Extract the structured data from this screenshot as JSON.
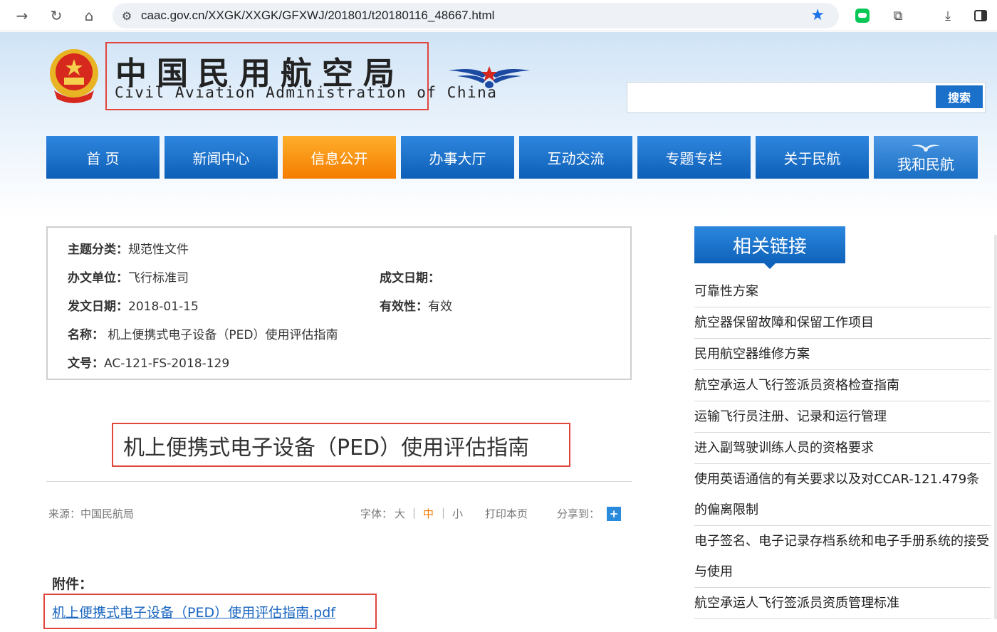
{
  "browser": {
    "url": "caac.gov.cn/XXGK/XXGK/GFXWJ/201801/t20180116_48667.html"
  },
  "site": {
    "logo_cn": "中国民用航空局",
    "logo_en": "Civil Aviation Administration of China",
    "search_button": "搜索",
    "search_placeholder": ""
  },
  "nav": {
    "items": [
      {
        "label": "首 页"
      },
      {
        "label": "新闻中心"
      },
      {
        "label": "信息公开"
      },
      {
        "label": "办事大厅"
      },
      {
        "label": "互动交流"
      },
      {
        "label": "专题专栏"
      },
      {
        "label": "关于民航"
      },
      {
        "label": "我和民航"
      }
    ],
    "active_index": 2
  },
  "info": {
    "topic_label": "主题分类：",
    "topic_value": "规范性文件",
    "dept_label": "办文单位：",
    "dept_value": "飞行标准司",
    "written_label": "成文日期：",
    "written_value": "",
    "issued_label": "发文日期：",
    "issued_value": "2018-01-15",
    "validity_label": "有效性：",
    "validity_value": "有效",
    "name_label": "名称：",
    "name_value": "机上便携式电子设备（PED）使用评估指南",
    "docno_label": "文号：",
    "docno_value": "AC-121-FS-2018-129"
  },
  "article": {
    "title": "机上便携式电子设备（PED）使用评估指南",
    "source": "来源：中国民航局",
    "font_label": "字体：",
    "font_large": "大",
    "font_medium": "中",
    "font_small": "小",
    "sep": "|",
    "print": "打印本页",
    "share": "分享到：",
    "share_plus": "+",
    "attachment_label": "附件：",
    "attachment_link": "机上便携式电子设备（PED）使用评估指南.pdf"
  },
  "sidebar": {
    "heading": "相关链接",
    "links": [
      {
        "label": "可靠性方案"
      },
      {
        "label": "航空器保留故障和保留工作项目"
      },
      {
        "label": "民用航空器维修方案"
      },
      {
        "label": "航空承运人飞行签派员资格检查指南"
      },
      {
        "label": "运输飞行员注册、记录和运行管理"
      },
      {
        "label": "进入副驾驶训练人员的资格要求"
      },
      {
        "label": "使用英语通信的有关要求以及对CCAR-121.479条的偏离限制"
      },
      {
        "label": "电子签名、电子记录存档系统和电子手册系统的接受与使用"
      },
      {
        "label": "航空承运人飞行签派员资质管理标准"
      }
    ]
  },
  "colors": {
    "nav_blue": "#0d5fb7",
    "nav_active_orange": "#f47c00",
    "highlight_red": "#e0463c",
    "link_blue": "#1a66c0"
  }
}
